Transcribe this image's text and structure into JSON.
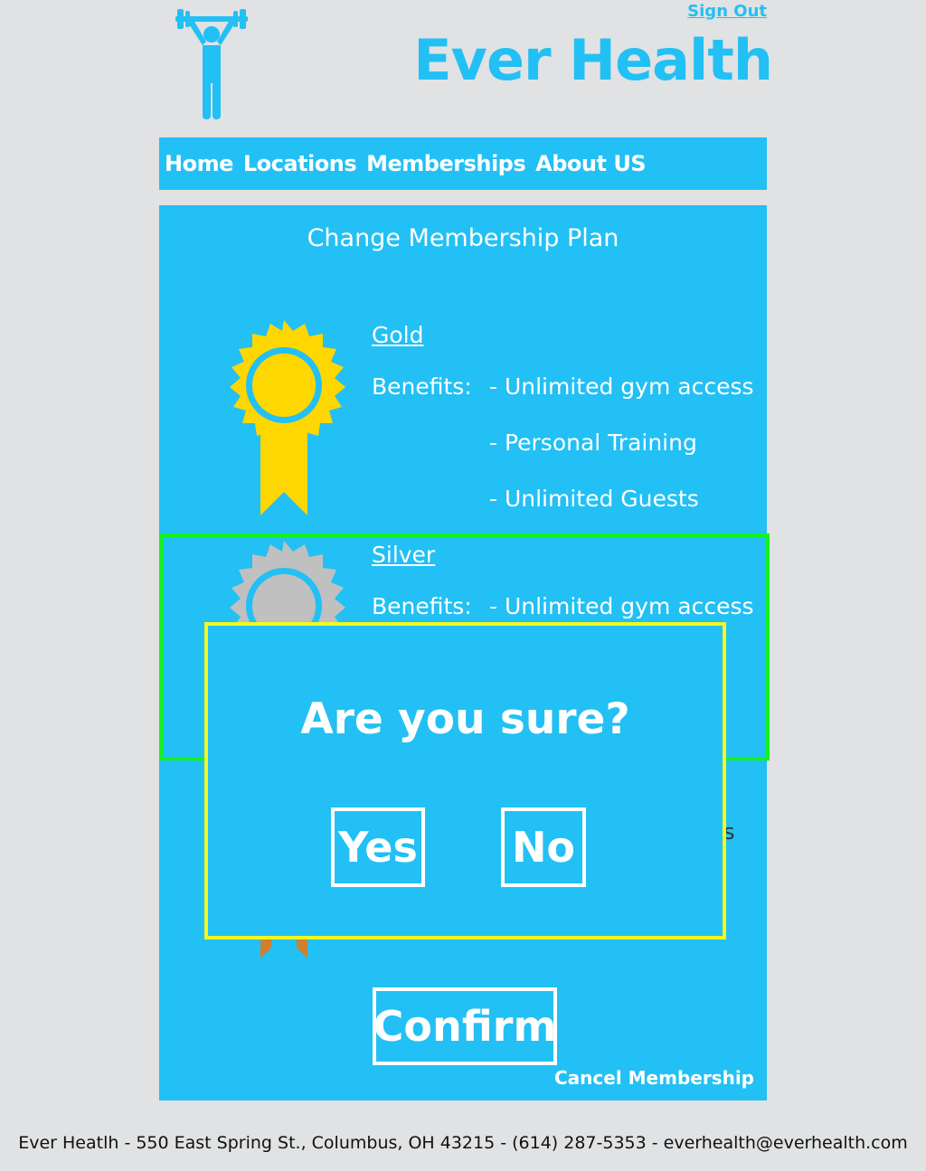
{
  "header": {
    "sign_out": "Sign Out",
    "title": "Ever Health",
    "logo_icon": "weightlifter-icon"
  },
  "nav": {
    "items": [
      {
        "label": "Home"
      },
      {
        "label": "Locations"
      },
      {
        "label": "Memberships"
      },
      {
        "label": "About US"
      }
    ]
  },
  "main": {
    "title": "Change Membership Plan",
    "plans": [
      {
        "name": "Gold",
        "benefits_label": "Benefits:",
        "benefits": [
          "- Unlimited gym access",
          "- Personal Training",
          "- Unlimited Guests"
        ],
        "icon": "gold-award-ribbon-icon",
        "color": "#ffd700"
      },
      {
        "name": "Silver",
        "benefits_label": "Benefits:",
        "benefits": [
          "- Unlimited gym access"
        ],
        "icon": "silver-award-ribbon-icon",
        "color": "#c0c0c0",
        "selected": true
      },
      {
        "icon": "bronze-award-ribbon-icon",
        "color": "#cd7f32"
      }
    ],
    "confirm_label": "Confirm",
    "cancel_label": "Cancel Membership"
  },
  "modal": {
    "question": "Are you sure?",
    "yes_label": "Yes",
    "no_label": "No"
  },
  "footer": {
    "text": "Ever Heatlh - 550 East Spring St., Columbus, OH 43215 - (614) 287-5353 - everhealth@everhealth.com"
  },
  "colors": {
    "accent": "#22c0f4",
    "background": "#e1e2e3",
    "selected_border": "#12f21e",
    "modal_border": "#f4f81e"
  }
}
